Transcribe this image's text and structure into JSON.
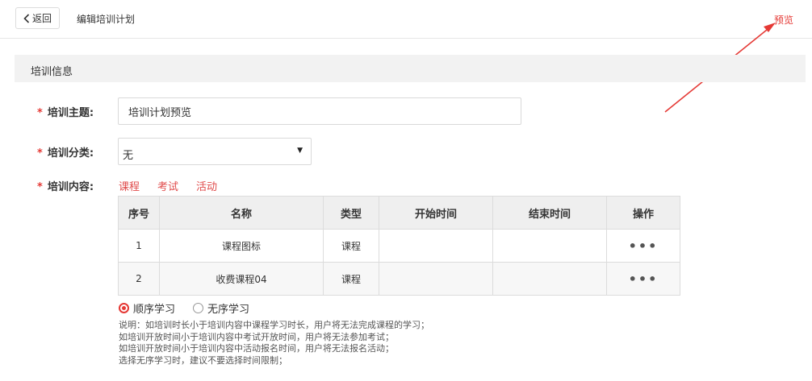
{
  "header": {
    "back_label": "返回",
    "page_title": "编辑培训计划",
    "preview_label": "预览"
  },
  "section": {
    "title": "培训信息"
  },
  "form": {
    "subject_label": "培训主题:",
    "subject_value": "培训计划预览",
    "category_label": "培训分类:",
    "category_value": "无",
    "content_label": "培训内容:",
    "content_links": [
      "课程",
      "考试",
      "活动"
    ]
  },
  "table": {
    "headers": [
      "序号",
      "名称",
      "类型",
      "开始时间",
      "结束时间",
      "操作"
    ],
    "rows": [
      {
        "index": "1",
        "name": "课程图标",
        "type": "课程",
        "start": "",
        "end": "",
        "action": "•••"
      },
      {
        "index": "2",
        "name": "收费课程04",
        "type": "课程",
        "start": "",
        "end": "",
        "action": "•••"
      }
    ]
  },
  "study_mode": {
    "options": [
      "顺序学习",
      "无序学习"
    ],
    "selected": "顺序学习"
  },
  "notes": [
    "说明：如培训时长小于培训内容中课程学习时长，用户将无法完成课程的学习；",
    "如培训开放时间小于培训内容中考试开放时间，用户将无法参加考试；",
    "如培训开放时间小于培训内容中活动报名时间，用户将无法报名活动；",
    "选择无序学习时，建议不要选择时间限制；"
  ],
  "colors": {
    "accent": "#e53935",
    "link": "#e04b4b",
    "section_bg": "#f2f2f2",
    "table_header_bg": "#efefef"
  }
}
